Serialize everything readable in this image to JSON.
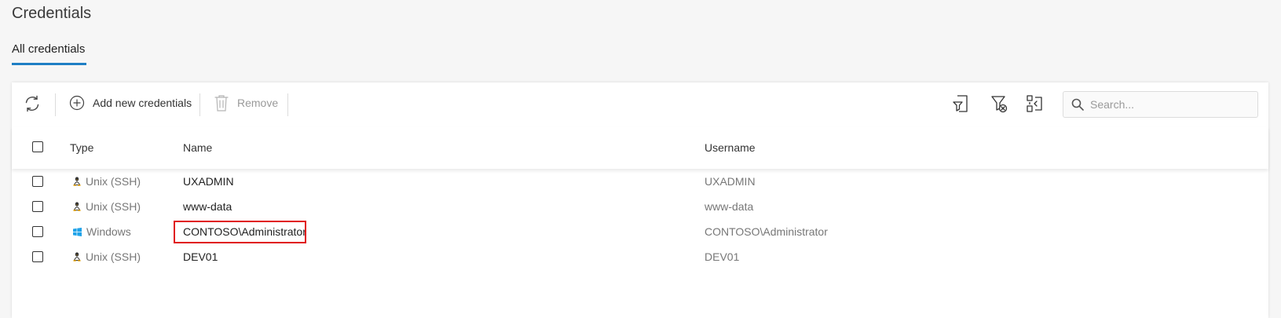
{
  "header": {
    "title": "Credentials"
  },
  "tabs": [
    {
      "label": "All credentials",
      "active": true
    }
  ],
  "toolbar": {
    "add_label": "Add new credentials",
    "remove_label": "Remove",
    "search_placeholder": "Search..."
  },
  "table": {
    "columns": {
      "type": "Type",
      "name": "Name",
      "username": "Username"
    },
    "rows": [
      {
        "type": "Unix (SSH)",
        "type_icon": "linux-icon",
        "name": "UXADMIN",
        "username": "UXADMIN"
      },
      {
        "type": "Unix (SSH)",
        "type_icon": "linux-icon",
        "name": "www-data",
        "username": "www-data"
      },
      {
        "type": "Windows",
        "type_icon": "windows-icon",
        "name": "CONTOSO\\Administrator",
        "username": "CONTOSO\\Administrator",
        "highlighted": true
      },
      {
        "type": "Unix (SSH)",
        "type_icon": "linux-icon",
        "name": "DEV01",
        "username": "DEV01"
      }
    ]
  },
  "colors": {
    "accent": "#1f7fc4",
    "highlight": "#e0141a",
    "windows": "#1fa2e8",
    "linux": "#e8a200"
  }
}
